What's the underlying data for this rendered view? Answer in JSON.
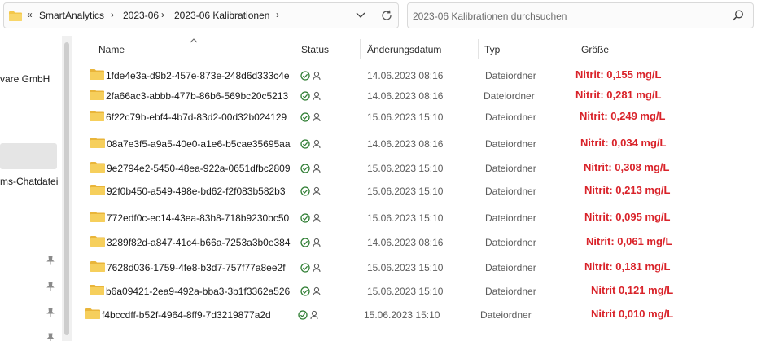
{
  "address": {
    "overflow": "«",
    "path": [
      "SmartAnalytics",
      "2023-06",
      "2023-06 Kalibrationen"
    ]
  },
  "search": {
    "placeholder": "2023-06 Kalibrationen durchsuchen"
  },
  "nav": {
    "items": [
      "vare GmbH",
      "ms-Chatdatei"
    ]
  },
  "columns": {
    "name": "Name",
    "status": "Status",
    "date": "Änderungsdatum",
    "type": "Typ",
    "size": "Größe"
  },
  "rows": [
    {
      "name": "1fde4e3a-d9b2-457e-873e-248d6d333c4e",
      "date": "14.06.2023 08:16",
      "type": "Dateiordner",
      "note": "Nitrit: 0,155 mg/L"
    },
    {
      "name": "2fa66ac3-abbb-477b-86b6-569bc20c5213",
      "date": "14.06.2023 08:16",
      "type": "Dateiordner",
      "note": "Nitrit: 0,281 mg/L"
    },
    {
      "name": "6f22c79b-ebf4-4b7d-83d2-00d32b024129",
      "date": "15.06.2023 15:10",
      "type": "Dateiordner",
      "note": "Nitrit: 0,249 mg/L"
    },
    {
      "name": "08a7e3f5-a9a5-40e0-a1e6-b5cae35695aa",
      "date": "14.06.2023 08:16",
      "type": "Dateiordner",
      "note": "Nitrit: 0,034 mg/L"
    },
    {
      "name": "9e2794e2-5450-48ea-922a-0651dfbc2809",
      "date": "15.06.2023 15:10",
      "type": "Dateiordner",
      "note": "Nitrit: 0,308 mg/L"
    },
    {
      "name": "92f0b450-a549-498e-bd62-f2f083b582b3",
      "date": "15.06.2023 15:10",
      "type": "Dateiordner",
      "note": "Nitrit: 0,213 mg/L"
    },
    {
      "name": "772edf0c-ec14-43ea-83b8-718b9230bc50",
      "date": "15.06.2023 15:10",
      "type": "Dateiordner",
      "note": "Nitrit: 0,095 mg/L"
    },
    {
      "name": "3289f82d-a847-41c4-b66a-7253a3b0e384",
      "date": "14.06.2023 08:16",
      "type": "Dateiordner",
      "note": "Nitrit: 0,061 mg/L"
    },
    {
      "name": "7628d036-1759-4fe8-b3d7-757f77a8ee2f",
      "date": "15.06.2023 15:10",
      "type": "Dateiordner",
      "note": "Nitrit: 0,181 mg/L"
    },
    {
      "name": "b6a09421-2ea9-492a-bba3-3b1f3362a526",
      "date": "15.06.2023 15:10",
      "type": "Dateiordner",
      "note": "Nitrit 0,121 mg/L"
    },
    {
      "name": "f4bccdff-b52f-4964-8ff9-7d3219877a2d",
      "date": "15.06.2023 15:10",
      "type": "Dateiordner",
      "note": "Nitrit 0,010 mg/L"
    }
  ],
  "icons": {
    "folder": "folder-icon",
    "status_synced": "check-circle-icon",
    "status_shared": "person-icon",
    "search": "search-icon",
    "refresh": "refresh-icon",
    "dropdown": "chevron-down-icon",
    "pin": "pin-icon"
  },
  "colors": {
    "folder": "#f3c74b",
    "status_ok": "#2e7d32",
    "note": "#d9232a",
    "nav_selected": "#e5e5e5"
  }
}
